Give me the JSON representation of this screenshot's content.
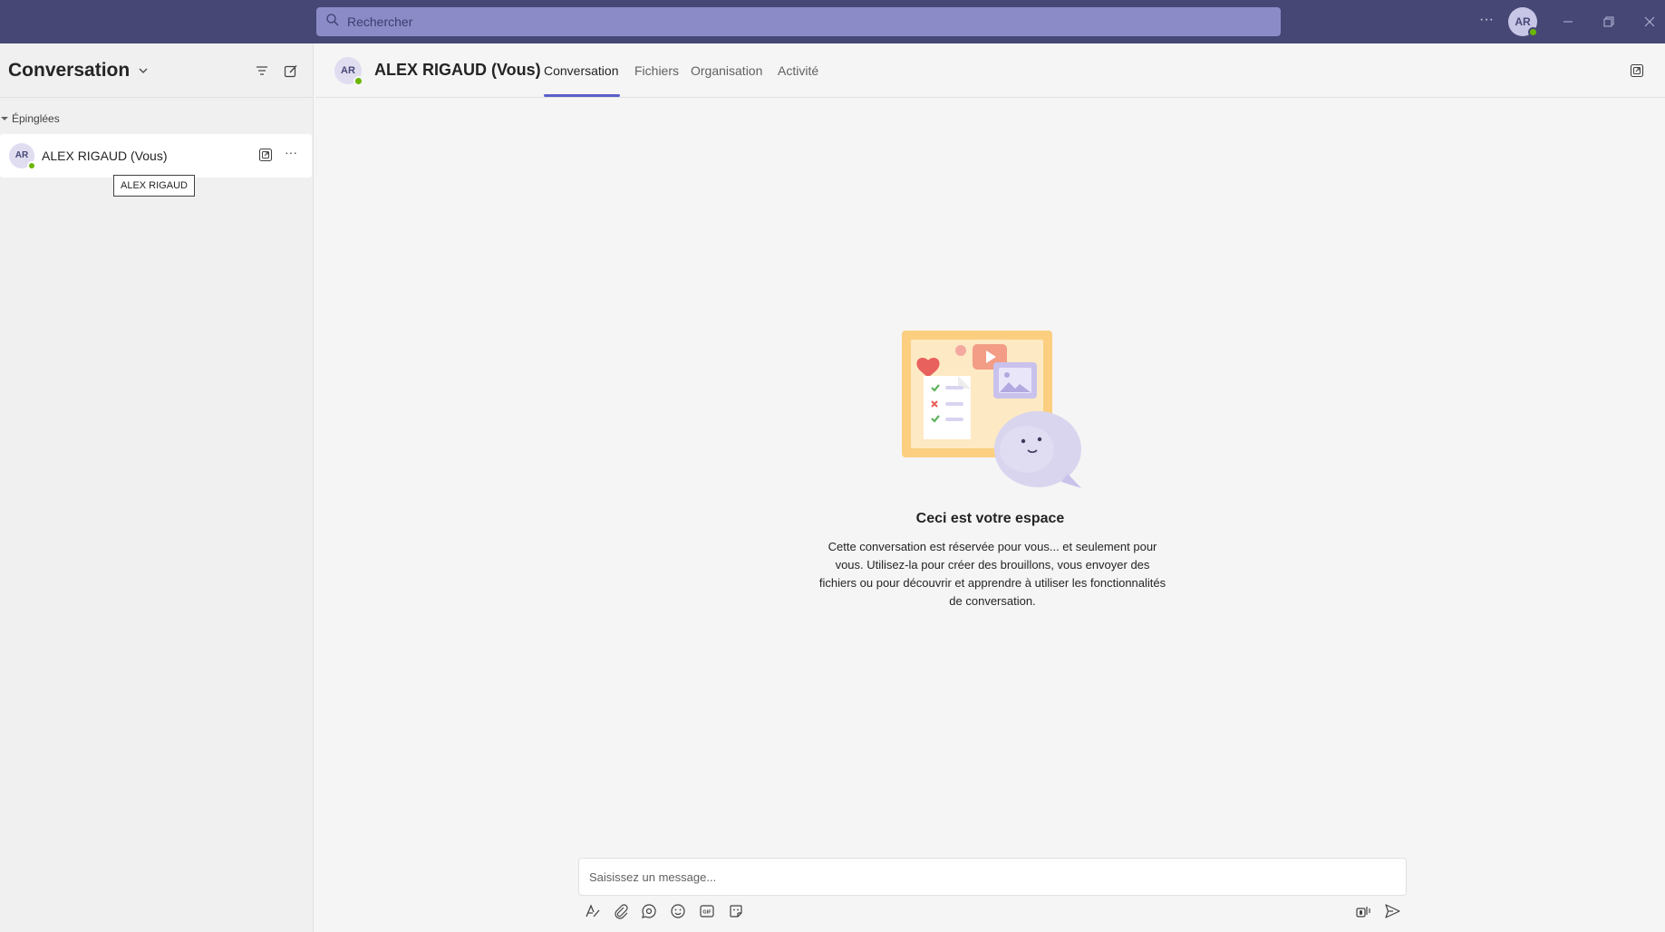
{
  "titlebar": {
    "search_placeholder": "Rechercher",
    "more_label": "···",
    "avatar_initials": "AR"
  },
  "left": {
    "title": "Conversation",
    "section_label": "Épinglées",
    "item": {
      "initials": "AR",
      "name": "ALEX RIGAUD (Vous)",
      "more_label": "···"
    },
    "tooltip": "ALEX RIGAUD"
  },
  "main": {
    "avatar_initials": "AR",
    "title": "ALEX RIGAUD (Vous)",
    "tabs": [
      {
        "label": "Conversation",
        "active": true
      },
      {
        "label": "Fichiers",
        "active": false
      },
      {
        "label": "Organisation",
        "active": false
      },
      {
        "label": "Activité",
        "active": false
      }
    ],
    "empty_title": "Ceci est votre espace",
    "empty_desc": "Cette conversation est réservée pour vous... et seulement pour vous. Utilisez-la pour créer des brouillons, vous envoyer des fichiers ou pour découvrir et apprendre à utiliser les fonctionnalités de conversation.",
    "compose_placeholder": "Saisissez un message..."
  },
  "colors": {
    "titlebar": "#464775",
    "accent": "#5b5fc7",
    "presence": "#6bb700"
  },
  "icons": [
    "search-icon",
    "more-icon",
    "minimize-icon",
    "restore-icon",
    "close-icon",
    "chevron-down-icon",
    "filter-icon",
    "new-chat-icon",
    "pop-out-icon",
    "format-icon",
    "attach-icon",
    "loop-icon",
    "emoji-icon",
    "gif-icon",
    "sticker-icon",
    "audio-message-icon",
    "send-icon"
  ]
}
